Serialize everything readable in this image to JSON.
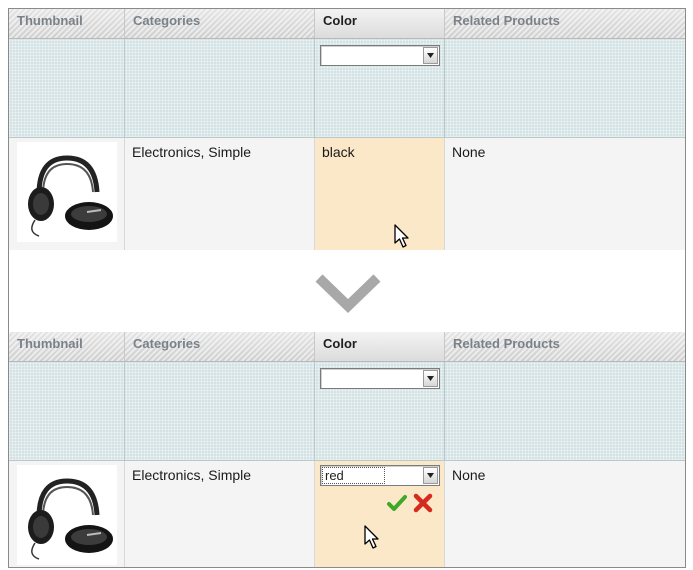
{
  "columns": [
    "Thumbnail",
    "Categories",
    "Color",
    "Related Products"
  ],
  "before": {
    "filter_color_value": "",
    "row": {
      "categories": "Electronics, Simple",
      "color": "black",
      "related": "None",
      "thumbnail_icon": "headphones-image"
    }
  },
  "after": {
    "filter_color_value": "",
    "row": {
      "categories": "Electronics, Simple",
      "color_select_value": "red",
      "related": "None",
      "thumbnail_icon": "headphones-image"
    }
  },
  "icons": {
    "transition": "chevron-down-icon",
    "save": "checkmark-icon",
    "cancel": "cross-icon",
    "pointer": "mouse-cursor-icon"
  },
  "colors": {
    "header_bg": "#d4d4d4",
    "filter_bg": "#d3e2e4",
    "row_bg": "#f4f4f4",
    "editing_cell_bg": "#fae8c8",
    "chevron": "#a8a8a8",
    "check": "#3fa82a",
    "cross": "#d62a1e"
  }
}
